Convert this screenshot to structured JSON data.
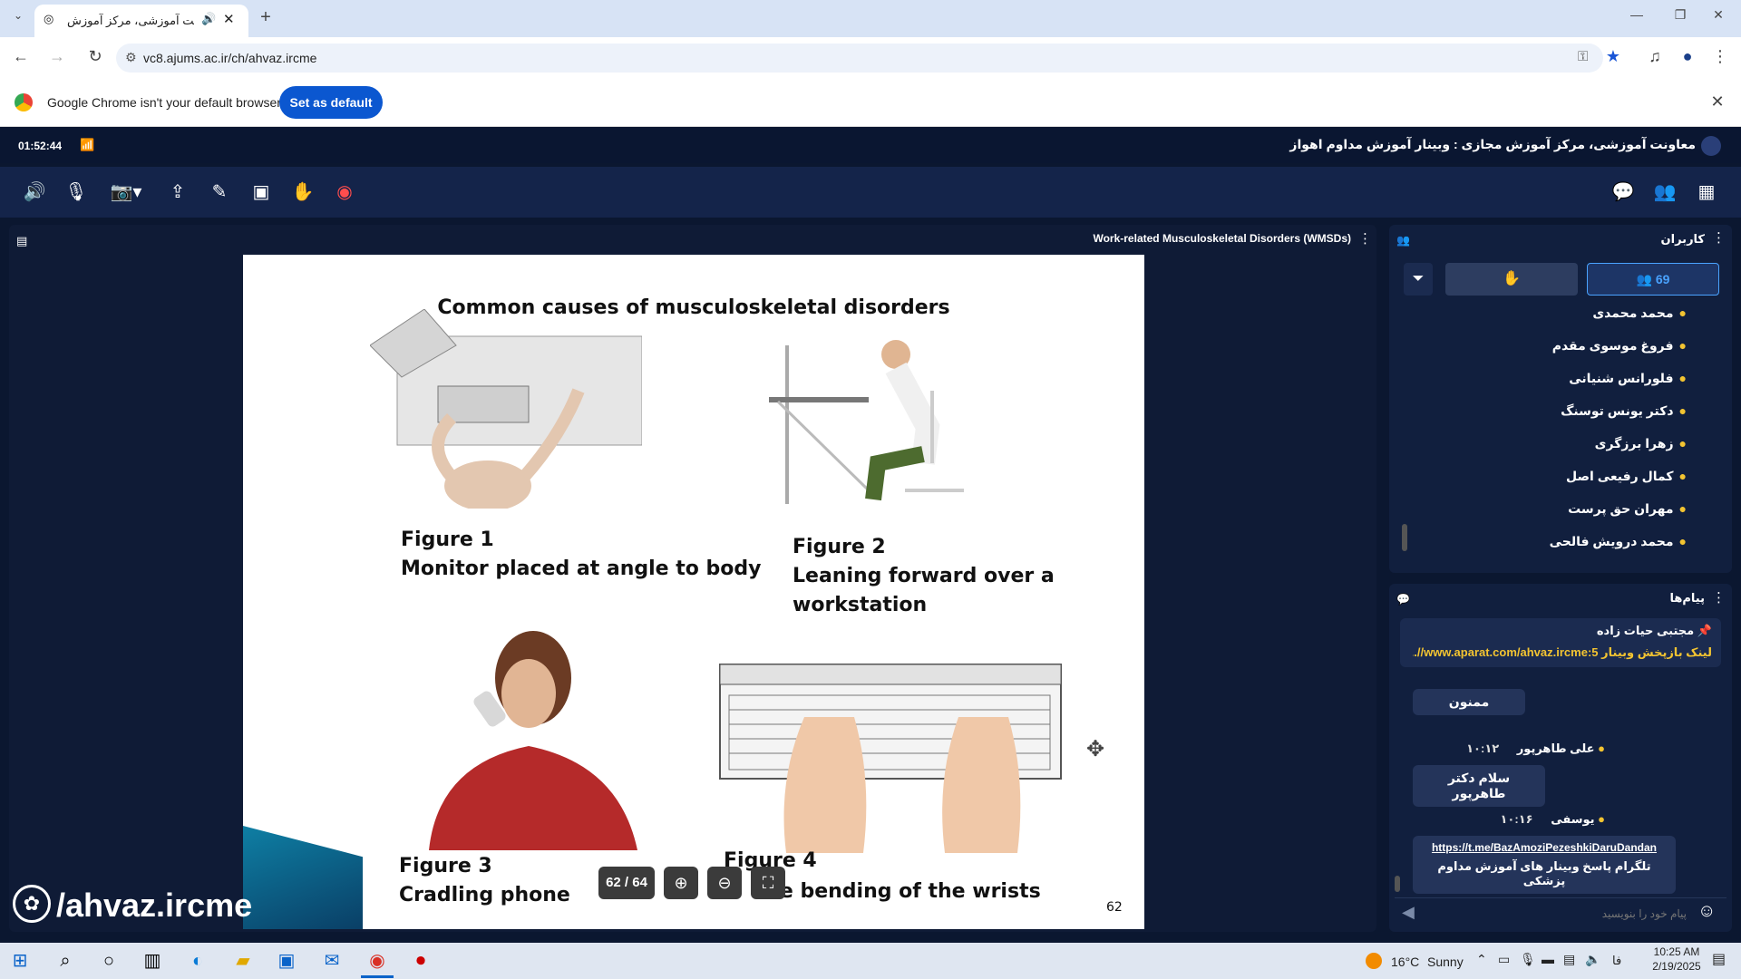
{
  "browser": {
    "tab_title": "معاونت آموزشی، مرکز آموزش",
    "url": "vc8.ajums.ac.ir/ch/ahvaz.ircme",
    "infobar_text": "Google Chrome isn't your default browser",
    "set_default_label": "Set as default"
  },
  "app": {
    "timer": "01:52:44",
    "title": "معاونت آموزشی، مرکز آموزش مجازی : وبینار آموزش مداوم اهواز",
    "presentation_title": "Work-related Musculoskeletal Disorders (WMSDs)",
    "page_indicator": "62 / 64",
    "watermark": "/ahvaz.ircme"
  },
  "slide": {
    "heading": "Common causes of musculoskeletal disorders",
    "fig1_title": "Figure 1",
    "fig1_caption": "Monitor placed at angle to body",
    "fig2_title": "Figure 2",
    "fig2_caption_1": "Leaning forward over a",
    "fig2_caption_2": "workstation",
    "fig3_title": "Figure 3",
    "fig3_caption": "Cradling phone",
    "fig4_title": "Figure 4",
    "fig4_caption": "ive bending of the wrists",
    "page_number": "62"
  },
  "users_panel": {
    "title": "کاربران",
    "count": "69",
    "users": [
      "محمد محمدی",
      "فروغ موسوی مقدم",
      "فلورانس شنیانی",
      "دکتر یونس توسنگ",
      "زهرا برزگری",
      "کمال رفیعی اصل",
      "مهران حق پرست",
      "محمد درویش فالحی"
    ]
  },
  "chat_panel": {
    "title": "پیام‌ها",
    "pinned_author": "مجتبی حیات زاده",
    "pinned_text": "لینک بازپخش وبینار 5:www.aparat.com/ahvaz.ircme//...",
    "messages": [
      {
        "author": "",
        "time": "",
        "text": "ممنون"
      },
      {
        "author": "علی طاهرپور",
        "time": "۱۰:۱۲",
        "text": "سلام دکتر طاهرپور"
      },
      {
        "author": "یوسفی",
        "time": "۱۰:۱۶",
        "link": "https://t.me/BazAmoziPezeshkiDaruDandan",
        "text": "تلگرام پاسخ وبینار های آموزش مداوم پزشکی"
      }
    ],
    "input_placeholder": "پیام خود را بنویسید"
  },
  "taskbar": {
    "weather_temp": "16°C",
    "weather_text": "Sunny",
    "lang": "فا",
    "time": "10:25 AM",
    "date": "2/19/2025"
  }
}
